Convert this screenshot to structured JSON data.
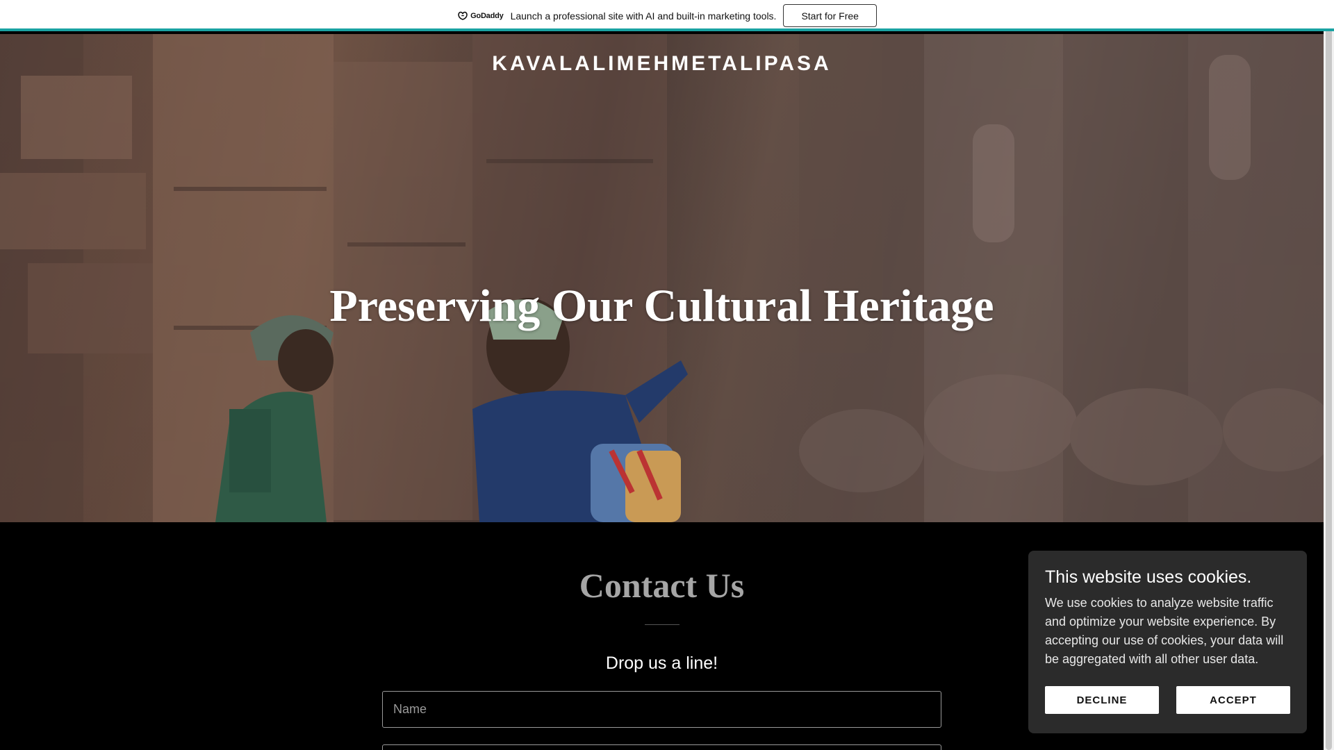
{
  "promo": {
    "logo_text": "GoDaddy",
    "message": "Launch a professional site with AI and built-in marketing tools.",
    "cta_label": "Start for Free"
  },
  "hero": {
    "site_name": "KAVALALIMEHMETALIPASA",
    "headline": "Preserving Our Cultural Heritage"
  },
  "contact": {
    "title": "Contact Us",
    "subtitle": "Drop us a line!",
    "name_placeholder": "Name",
    "email_placeholder": ""
  },
  "cookie_banner": {
    "title": "This website uses cookies.",
    "body": "We use cookies to analyze website traffic and optimize your website experience. By accepting our use of cookies, your data will be aggregated with all other user data.",
    "decline_label": "DECLINE",
    "accept_label": "ACCEPT"
  },
  "colors": {
    "promo_accent": "#1aa3a3",
    "cookie_background": "#2b2b2b",
    "page_background": "#000000"
  }
}
